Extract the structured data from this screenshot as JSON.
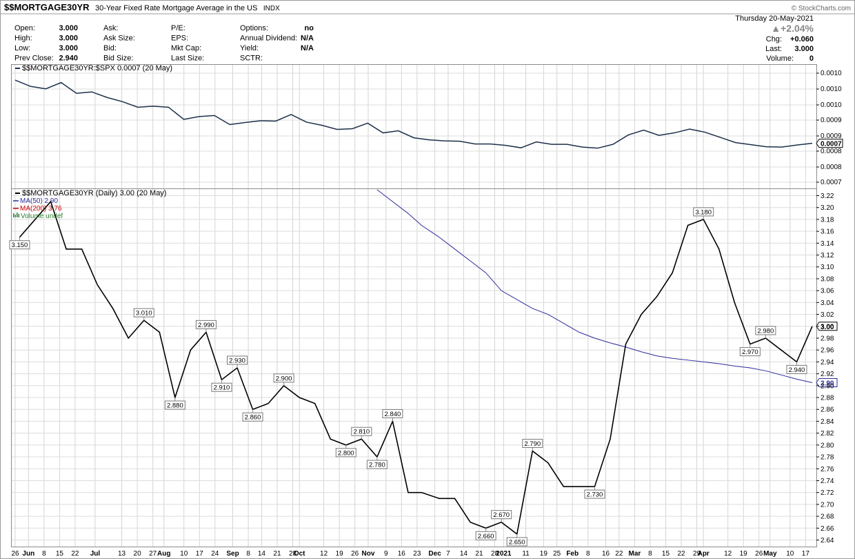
{
  "header": {
    "symbol": "$$MORTGAGE30YR",
    "description": "30-Year Fixed Rate Mortgage Average in the US",
    "exchange": "INDX",
    "watermark": "© StockCharts.com",
    "date": "Thursday  20-May-2021",
    "pct_change": "▲+2.04%",
    "change_label": "Chg:",
    "change_value": "+0.060",
    "last_label": "Last:",
    "last_value": "3.000",
    "volume_label": "Volume:",
    "volume_value": "0",
    "stats": [
      {
        "label": "Open:",
        "value": "3.000"
      },
      {
        "label": "High:",
        "value": "3.000"
      },
      {
        "label": "Low:",
        "value": "3.000"
      },
      {
        "label": "Prev Close:",
        "value": "2.940"
      }
    ],
    "stats2": [
      {
        "label": "Ask:",
        "value": ""
      },
      {
        "label": "Ask Size:",
        "value": ""
      },
      {
        "label": "Bid:",
        "value": ""
      },
      {
        "label": "Bid Size:",
        "value": ""
      }
    ],
    "stats3": [
      {
        "label": "P/E:",
        "value": ""
      },
      {
        "label": "EPS:",
        "value": ""
      },
      {
        "label": "Mkt Cap:",
        "value": ""
      },
      {
        "label": "Last Size:",
        "value": ""
      }
    ],
    "stats4": [
      {
        "label": "Options:",
        "value": "no"
      },
      {
        "label": "Annual Dividend:",
        "value": "N/A"
      },
      {
        "label": "Yield:",
        "value": "N/A"
      },
      {
        "label": "SCTR:",
        "value": ""
      }
    ]
  },
  "colors": {
    "ratio_line": "#1c2e4a",
    "price_line": "#000000",
    "ma50": "#2a2a9a",
    "ma200": "#cc0000",
    "volume": "#2e7d32"
  },
  "chart_data": [
    {
      "type": "line",
      "panel": "ratio",
      "legend": "$$MORTGAGE30YR:$SPX 0.0007 (20 May)",
      "ylim": [
        0.0007,
        0.00105
      ],
      "yticks": [
        "0.0010",
        "0.0010",
        "0.0010",
        "0.0009",
        "0.0009",
        "0.0008",
        "0.0008",
        "0.0007"
      ],
      "last_label": "0.0007",
      "values": [
        0.00101,
        0.000992,
        0.000985,
        0.001003,
        0.000972,
        0.000976,
        0.00096,
        0.000948,
        0.000932,
        0.000935,
        0.000932,
        0.000897,
        0.000905,
        0.000908,
        0.000882,
        0.000888,
        0.000893,
        0.000892,
        0.000911,
        0.000889,
        0.00088,
        0.000868,
        0.00087,
        0.000886,
        0.000858,
        0.000864,
        0.000844,
        0.000838,
        0.000835,
        0.000834,
        0.000826,
        0.000826,
        0.000822,
        0.000815,
        0.000832,
        0.000825,
        0.000825,
        0.000817,
        0.000814,
        0.000825,
        0.000852,
        0.000866,
        0.000851,
        0.000858,
        0.000869,
        0.00086,
        0.000845,
        0.00083,
        0.000824,
        0.000818,
        0.000817,
        0.000823,
        0.000828
      ]
    },
    {
      "type": "line",
      "panel": "price",
      "legend": "$$MORTGAGE30YR (Daily) 3.00 (20 May)",
      "ma50_legend": "MA(50) 2.90",
      "ma200_legend": "MA(200) 3.76",
      "volume_legend": "Volume undef",
      "ylim": [
        2.635,
        3.225
      ],
      "yticks": [
        "3.22",
        "3.20",
        "3.18",
        "3.16",
        "3.14",
        "3.12",
        "3.10",
        "3.08",
        "3.06",
        "3.04",
        "3.02",
        "3.00",
        "2.98",
        "2.96",
        "2.94",
        "2.92",
        "2.90",
        "2.88",
        "2.86",
        "2.84",
        "2.82",
        "2.80",
        "2.78",
        "2.76",
        "2.74",
        "2.72",
        "2.70",
        "2.68",
        "2.66",
        "2.64"
      ],
      "last_label": "3.00",
      "ma50_last_label": "2.90",
      "x": [
        "2020-05-28",
        "2020-06-04",
        "2020-06-11",
        "2020-06-18",
        "2020-06-25",
        "2020-07-02",
        "2020-07-09",
        "2020-07-16",
        "2020-07-23",
        "2020-07-30",
        "2020-08-06",
        "2020-08-13",
        "2020-08-20",
        "2020-08-27",
        "2020-09-03",
        "2020-09-10",
        "2020-09-17",
        "2020-09-24",
        "2020-10-01",
        "2020-10-08",
        "2020-10-15",
        "2020-10-22",
        "2020-10-29",
        "2020-11-05",
        "2020-11-12",
        "2020-11-19",
        "2020-11-25",
        "2020-12-03",
        "2020-12-10",
        "2020-12-17",
        "2020-12-24",
        "2020-12-31",
        "2021-01-07",
        "2021-01-14",
        "2021-01-21",
        "2021-01-28",
        "2021-02-04",
        "2021-02-11",
        "2021-02-18",
        "2021-02-25",
        "2021-03-04",
        "2021-03-11",
        "2021-03-18",
        "2021-03-25",
        "2021-04-01",
        "2021-04-08",
        "2021-04-15",
        "2021-04-22",
        "2021-04-29",
        "2021-05-06",
        "2021-05-13",
        "2021-05-20"
      ],
      "values": [
        3.15,
        3.18,
        3.21,
        3.13,
        3.13,
        3.07,
        3.03,
        2.98,
        3.01,
        2.99,
        2.88,
        2.96,
        2.99,
        2.91,
        2.93,
        2.86,
        2.87,
        2.9,
        2.88,
        2.87,
        2.81,
        2.8,
        2.81,
        2.78,
        2.84,
        2.72,
        2.72,
        2.71,
        2.71,
        2.67,
        2.66,
        2.67,
        2.65,
        2.79,
        2.77,
        2.73,
        2.73,
        2.73,
        2.81,
        2.97,
        3.02,
        3.05,
        3.09,
        3.17,
        3.18,
        3.13,
        3.04,
        2.97,
        2.98,
        2.96,
        2.94,
        3.0
      ],
      "data_labels": [
        {
          "i": 0,
          "text": "3.150"
        },
        {
          "i": 8,
          "text": "3.010"
        },
        {
          "i": 10,
          "text": "2.880"
        },
        {
          "i": 12,
          "text": "2.990"
        },
        {
          "i": 13,
          "text": "2.910"
        },
        {
          "i": 14,
          "text": "2.930"
        },
        {
          "i": 15,
          "text": "2.860"
        },
        {
          "i": 17,
          "text": "2.900"
        },
        {
          "i": 21,
          "text": "2.800"
        },
        {
          "i": 22,
          "text": "2.810"
        },
        {
          "i": 23,
          "text": "2.780"
        },
        {
          "i": 24,
          "text": "2.840"
        },
        {
          "i": 30,
          "text": "2.660"
        },
        {
          "i": 31,
          "text": "2.670"
        },
        {
          "i": 32,
          "text": "2.650"
        },
        {
          "i": 33,
          "text": "2.790"
        },
        {
          "i": 37,
          "text": "2.730"
        },
        {
          "i": 44,
          "text": "3.180"
        },
        {
          "i": 47,
          "text": "2.970"
        },
        {
          "i": 48,
          "text": "2.980"
        },
        {
          "i": 50,
          "text": "2.940"
        }
      ],
      "ma50": [
        null,
        null,
        null,
        null,
        null,
        null,
        null,
        null,
        null,
        null,
        null,
        null,
        null,
        null,
        null,
        null,
        null,
        null,
        null,
        null,
        null,
        null,
        null,
        3.23,
        3.21,
        3.19,
        3.17,
        3.15,
        3.13,
        3.11,
        3.09,
        3.06,
        3.045,
        3.03,
        3.02,
        3.005,
        2.99,
        2.98,
        2.972,
        2.965,
        2.957,
        2.95,
        2.946,
        2.943,
        2.94,
        2.937,
        2.933,
        2.93,
        2.925,
        2.918,
        2.911,
        2.905
      ]
    }
  ],
  "x_axis": {
    "ticks": [
      {
        "d": "2020-05-26",
        "t": "26"
      },
      {
        "d": "2020-06-01",
        "t": "Jun",
        "b": true
      },
      {
        "d": "2020-06-08",
        "t": "8"
      },
      {
        "d": "2020-06-15",
        "t": "15"
      },
      {
        "d": "2020-06-22",
        "t": "22"
      },
      {
        "d": "2020-07-01",
        "t": "Jul",
        "b": true
      },
      {
        "d": "2020-07-13",
        "t": "13"
      },
      {
        "d": "2020-07-20",
        "t": "20"
      },
      {
        "d": "2020-07-27",
        "t": "27"
      },
      {
        "d": "2020-08-01",
        "t": "Aug",
        "b": true
      },
      {
        "d": "2020-08-10",
        "t": "10"
      },
      {
        "d": "2020-08-17",
        "t": "17"
      },
      {
        "d": "2020-08-24",
        "t": "24"
      },
      {
        "d": "2020-09-01",
        "t": "Sep",
        "b": true
      },
      {
        "d": "2020-09-08",
        "t": "8"
      },
      {
        "d": "2020-09-14",
        "t": "14"
      },
      {
        "d": "2020-09-21",
        "t": "21"
      },
      {
        "d": "2020-09-28",
        "t": "28"
      },
      {
        "d": "2020-10-01",
        "t": "Oct",
        "b": true
      },
      {
        "d": "2020-10-12",
        "t": "12"
      },
      {
        "d": "2020-10-19",
        "t": "19"
      },
      {
        "d": "2020-10-26",
        "t": "26"
      },
      {
        "d": "2020-11-01",
        "t": "Nov",
        "b": true
      },
      {
        "d": "2020-11-09",
        "t": "9"
      },
      {
        "d": "2020-11-16",
        "t": "16"
      },
      {
        "d": "2020-11-23",
        "t": "23"
      },
      {
        "d": "2020-12-01",
        "t": "Dec",
        "b": true
      },
      {
        "d": "2020-12-07",
        "t": "7"
      },
      {
        "d": "2020-12-14",
        "t": "14"
      },
      {
        "d": "2020-12-21",
        "t": "21"
      },
      {
        "d": "2020-12-28",
        "t": "28"
      },
      {
        "d": "2021-01-01",
        "t": "2021",
        "b": true
      },
      {
        "d": "2021-01-11",
        "t": "11"
      },
      {
        "d": "2021-01-19",
        "t": "19"
      },
      {
        "d": "2021-01-25",
        "t": "25"
      },
      {
        "d": "2021-02-01",
        "t": "Feb",
        "b": true
      },
      {
        "d": "2021-02-08",
        "t": "8"
      },
      {
        "d": "2021-02-16",
        "t": "16"
      },
      {
        "d": "2021-02-22",
        "t": "22"
      },
      {
        "d": "2021-03-01",
        "t": "Mar",
        "b": true
      },
      {
        "d": "2021-03-08",
        "t": "8"
      },
      {
        "d": "2021-03-15",
        "t": "15"
      },
      {
        "d": "2021-03-22",
        "t": "22"
      },
      {
        "d": "2021-03-29",
        "t": "29"
      },
      {
        "d": "2021-04-01",
        "t": "Apr",
        "b": true
      },
      {
        "d": "2021-04-12",
        "t": "12"
      },
      {
        "d": "2021-04-19",
        "t": "19"
      },
      {
        "d": "2021-04-26",
        "t": "26"
      },
      {
        "d": "2021-05-01",
        "t": "May",
        "b": true
      },
      {
        "d": "2021-05-10",
        "t": "10"
      },
      {
        "d": "2021-05-17",
        "t": "17"
      }
    ]
  }
}
